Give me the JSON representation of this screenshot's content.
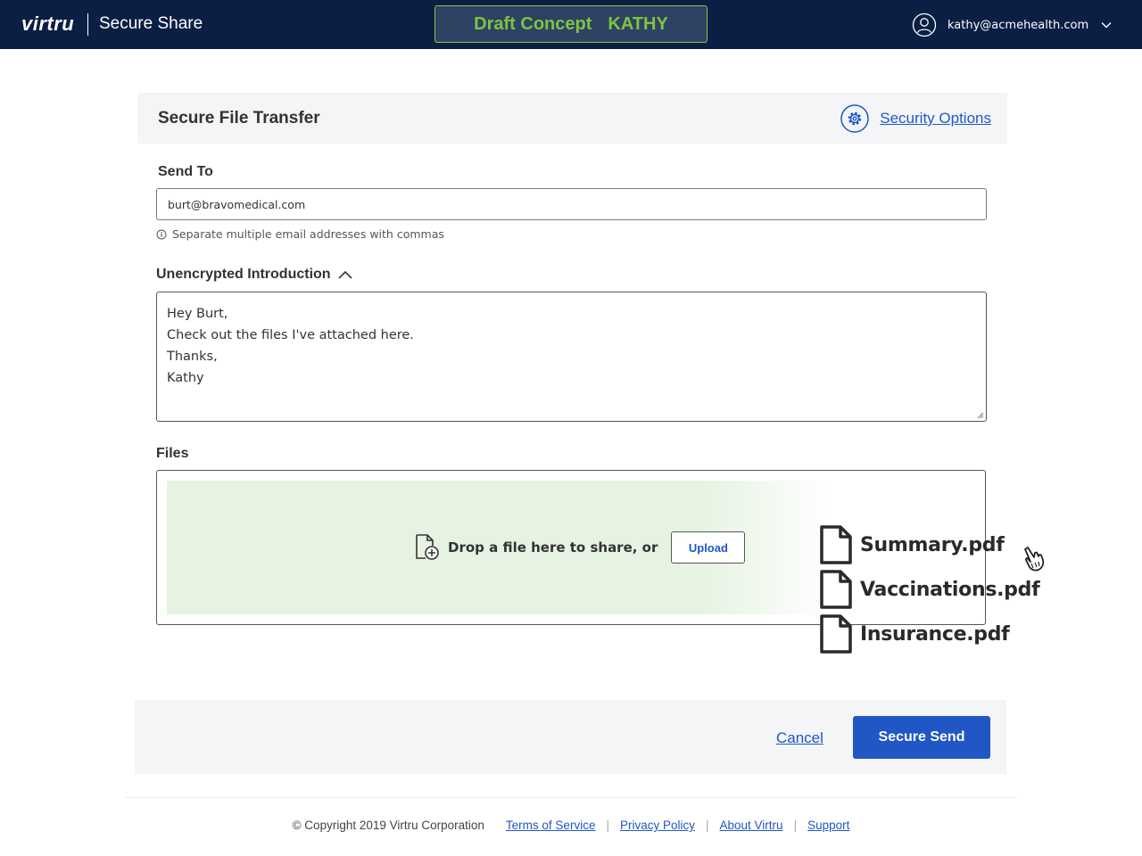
{
  "topbar": {
    "logo": "virtru",
    "app_name": "Secure Share",
    "draft_badge": {
      "left": "Draft Concept",
      "right": "KATHY"
    },
    "user_email": "kathy@acmehealth.com"
  },
  "panel": {
    "title": "Secure File Transfer",
    "security_options": "Security Options"
  },
  "send_to": {
    "label": "Send To",
    "value": "burt@bravomedical.com",
    "hint": "Separate multiple email addresses with commas"
  },
  "intro": {
    "label": "Unencrypted Introduction",
    "lines": [
      "Hey Burt,",
      "Check out the files I've attached here.",
      "Thanks,",
      "Kathy"
    ]
  },
  "files": {
    "label": "Files",
    "drop_text": "Drop a file here to share, or",
    "upload_label": "Upload",
    "dragged": [
      "Summary.pdf",
      "Vaccinations.pdf",
      "Insurance.pdf"
    ]
  },
  "actions": {
    "cancel": "Cancel",
    "send": "Secure Send"
  },
  "footer": {
    "copyright": "© Copyright 2019 Virtru Corporation",
    "links": [
      "Terms of Service",
      "Privacy Policy",
      "About Virtru",
      "Support"
    ]
  },
  "colors": {
    "navbar": "#0b1f45",
    "accent": "#2157c5",
    "badge_text": "#7cc444",
    "dropzone": "#e6f3e2"
  }
}
